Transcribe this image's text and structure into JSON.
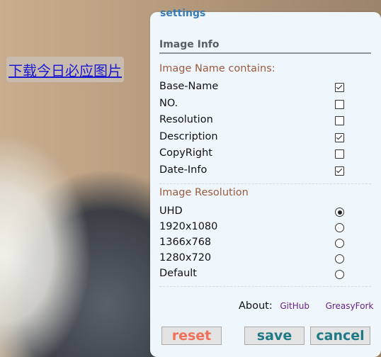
{
  "download_button": {
    "label": "下载今日必应图片"
  },
  "panel": {
    "title": "settings",
    "section_title": "Image Info",
    "name_group_label": "Image Name contains:",
    "name_options": [
      {
        "label": "Base-Name",
        "checked": true
      },
      {
        "label": "NO.",
        "checked": false
      },
      {
        "label": "Resolution",
        "checked": false
      },
      {
        "label": "Description",
        "checked": true
      },
      {
        "label": "CopyRight",
        "checked": false
      },
      {
        "label": "Date-Info",
        "checked": true
      }
    ],
    "resolution_group_label": "Image Resolution",
    "resolution_options": [
      {
        "label": "UHD",
        "selected": true
      },
      {
        "label": "1920x1080",
        "selected": false
      },
      {
        "label": "1366x768",
        "selected": false
      },
      {
        "label": "1280x720",
        "selected": false
      },
      {
        "label": "Default",
        "selected": false
      }
    ],
    "about_label": "About:",
    "about_links": [
      "GitHub",
      "GreasyFork"
    ],
    "buttons": {
      "reset": "reset",
      "save": "save",
      "cancel": "cancel"
    }
  },
  "colors": {
    "accent": "#3b7bb5",
    "group_label": "#9a5a3e",
    "reset": "#f0705a",
    "save": "#1f7a86",
    "link": "#6a1f8a"
  }
}
